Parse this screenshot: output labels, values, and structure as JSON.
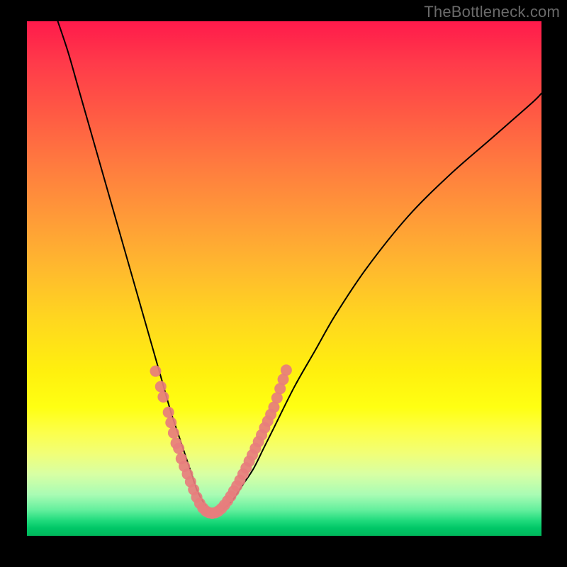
{
  "watermark": "TheBottleneck.com",
  "chart_data": {
    "type": "line",
    "title": "",
    "xlabel": "",
    "ylabel": "",
    "xlim": [
      0,
      100
    ],
    "ylim": [
      0,
      100
    ],
    "curve": {
      "name": "bottleneck-curve",
      "x": [
        6,
        8,
        10,
        12,
        14,
        16,
        18,
        20,
        22,
        24,
        26,
        28,
        30,
        32,
        33,
        34,
        35,
        36,
        37,
        38,
        40,
        42,
        44,
        46,
        48,
        52,
        56,
        60,
        66,
        74,
        82,
        90,
        98,
        100
      ],
      "y": [
        100,
        94,
        87,
        80,
        73,
        66,
        59,
        52,
        45,
        38,
        31,
        24,
        18,
        12,
        9,
        7,
        5.5,
        4.5,
        4.5,
        5,
        7,
        10,
        13,
        17,
        21,
        29,
        36,
        43,
        52,
        62,
        70,
        77,
        84,
        86
      ]
    },
    "marker_clusters": [
      {
        "name": "left-cluster",
        "color": "#e77d7d",
        "points": [
          {
            "x": 25.0,
            "y": 32
          },
          {
            "x": 26.0,
            "y": 29
          },
          {
            "x": 26.5,
            "y": 27
          },
          {
            "x": 27.5,
            "y": 24
          },
          {
            "x": 28.0,
            "y": 22
          },
          {
            "x": 28.5,
            "y": 20
          },
          {
            "x": 29.0,
            "y": 18
          },
          {
            "x": 29.5,
            "y": 17
          },
          {
            "x": 30.0,
            "y": 15
          },
          {
            "x": 30.6,
            "y": 13.5
          },
          {
            "x": 31.2,
            "y": 12
          },
          {
            "x": 31.8,
            "y": 10.5
          },
          {
            "x": 32.4,
            "y": 9
          },
          {
            "x": 33.0,
            "y": 7.5
          },
          {
            "x": 33.6,
            "y": 6.3
          },
          {
            "x": 34.2,
            "y": 5.4
          },
          {
            "x": 34.8,
            "y": 4.8
          },
          {
            "x": 35.4,
            "y": 4.5
          },
          {
            "x": 36.0,
            "y": 4.4
          },
          {
            "x": 36.6,
            "y": 4.5
          },
          {
            "x": 37.2,
            "y": 4.8
          },
          {
            "x": 37.8,
            "y": 5.3
          },
          {
            "x": 38.4,
            "y": 6.0
          }
        ]
      },
      {
        "name": "right-cluster",
        "color": "#e77d7d",
        "points": [
          {
            "x": 39.0,
            "y": 6.8
          },
          {
            "x": 39.6,
            "y": 7.7
          },
          {
            "x": 40.2,
            "y": 8.7
          },
          {
            "x": 40.8,
            "y": 9.7
          },
          {
            "x": 41.4,
            "y": 10.8
          },
          {
            "x": 42.0,
            "y": 12.0
          },
          {
            "x": 42.6,
            "y": 13.2
          },
          {
            "x": 43.2,
            "y": 14.5
          },
          {
            "x": 43.8,
            "y": 15.7
          },
          {
            "x": 44.4,
            "y": 17.0
          },
          {
            "x": 45.0,
            "y": 18.3
          },
          {
            "x": 45.6,
            "y": 19.6
          },
          {
            "x": 46.2,
            "y": 21.0
          },
          {
            "x": 46.8,
            "y": 22.3
          },
          {
            "x": 47.4,
            "y": 23.6
          },
          {
            "x": 48.0,
            "y": 25.0
          },
          {
            "x": 48.6,
            "y": 26.8
          },
          {
            "x": 49.2,
            "y": 28.6
          },
          {
            "x": 49.8,
            "y": 30.4
          },
          {
            "x": 50.4,
            "y": 32.2
          }
        ]
      }
    ],
    "background_gradient": {
      "stops": [
        {
          "pos": 0.0,
          "color": "#ff1a4b"
        },
        {
          "pos": 0.5,
          "color": "#ffc825"
        },
        {
          "pos": 0.75,
          "color": "#ffff12"
        },
        {
          "pos": 0.92,
          "color": "#a9fcb4"
        },
        {
          "pos": 1.0,
          "color": "#00b85c"
        }
      ]
    }
  }
}
